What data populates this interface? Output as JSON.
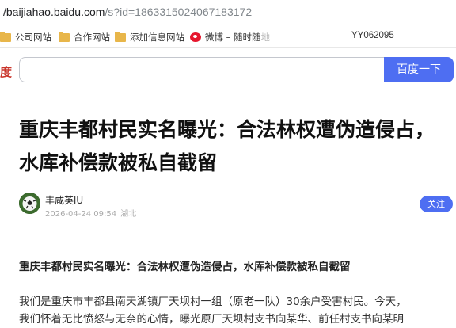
{
  "browser": {
    "url_host": "/baijiahao.baidu.com",
    "url_path": "/s?id=1863315024067183172"
  },
  "bookmarks": [
    {
      "label": "公司网站",
      "icon": "folder-icon"
    },
    {
      "label": "合作网站",
      "icon": "folder-icon"
    },
    {
      "label": "添加信息网站",
      "icon": "folder-icon"
    },
    {
      "label": "微博 – 随时随",
      "icon": "weibo-icon"
    }
  ],
  "bookmark_fade": "地",
  "bookmark_right": "YY062095",
  "search": {
    "logo_fragment": "度",
    "value": "",
    "button_label": "百度一下"
  },
  "article": {
    "title": "重庆丰都村民实名曝光：合法林权遭伪造侵占，水库补偿款被私自截留",
    "author": "丰咸英lU",
    "date": "2026-04-24 09:54",
    "location": "湖北",
    "follow_label": "关注",
    "section_heading": "重庆丰都村民实名曝光：合法林权遭伪造侵占，水库补偿款被私自截留",
    "paragraph_line1": "我们是重庆市丰都县南天湖镇厂天坝村一组（原老一队）30余户受害村民。今天，",
    "paragraph_line2": "我们怀着无比愤怒与无奈的心情，曝光原厂天坝村支书向某华、前任村支书向某明"
  },
  "colors": {
    "accent": "#4e6ef2",
    "folder": "#e8b64a",
    "weibo": "#e6162d"
  }
}
